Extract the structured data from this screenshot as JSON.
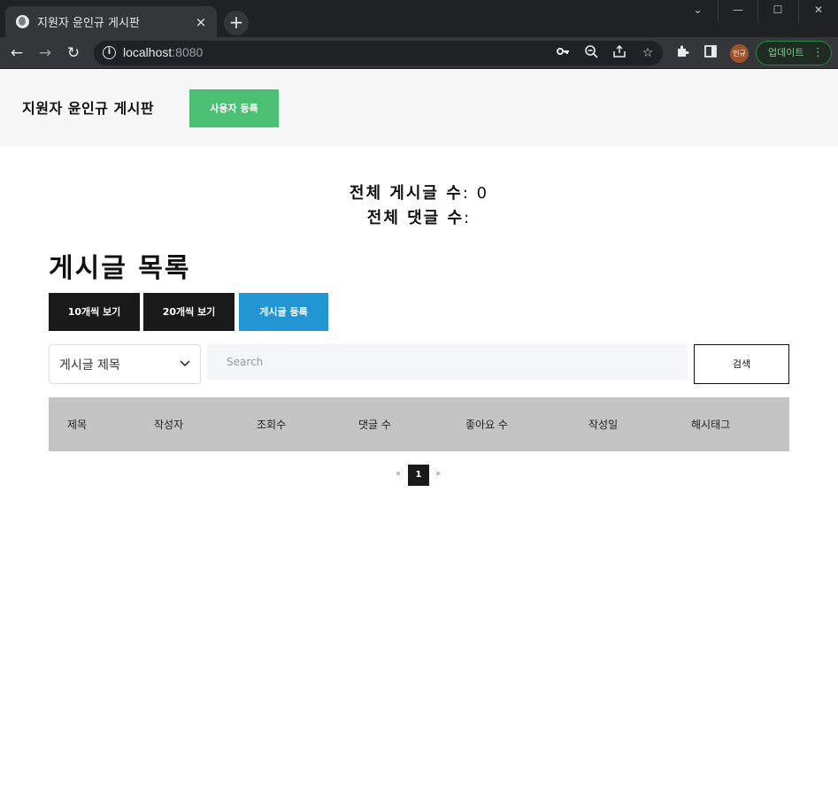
{
  "browser": {
    "tab_title": "지원자 윤인규 게시판",
    "tab_close": "×",
    "new_tab": "+",
    "url_host": "localhost",
    "url_port": ":8080",
    "profile_initials": "인규",
    "update_label": "업데이트",
    "window_controls": [
      "⌄",
      "—",
      "☐",
      "✕"
    ]
  },
  "header": {
    "site_title": "지원자 윤인규 게시판",
    "user_register_label": "사용자 등록"
  },
  "stats": {
    "total_posts_label": "전체 게시글 수",
    "total_posts_value": ": 0",
    "total_comments_label": "전체 댓글 수",
    "total_comments_value": ":"
  },
  "board": {
    "title": "게시글 목록",
    "view10_label": "10개씩 보기",
    "view20_label": "20개씩 보기",
    "post_register_label": "게시글 등록",
    "search_select_value": "게시글 제목",
    "search_placeholder": "Search",
    "search_button_label": "검색",
    "columns": [
      "제목",
      "작성자",
      "조회수",
      "댓글 수",
      "좋아요 수",
      "작성일",
      "해시태그"
    ],
    "rows": []
  },
  "pagination": {
    "prev": "«",
    "current": "1",
    "next": "»"
  },
  "colors": {
    "accent_green": "#4bbf73",
    "accent_blue": "#2196d3",
    "dark_button": "#1a1a1a",
    "table_header": "#c4c4c4"
  },
  "icons": [
    "globe-icon",
    "back-icon",
    "forward-icon",
    "reload-icon",
    "info-icon",
    "key-icon",
    "zoom-out-icon",
    "share-icon",
    "star-icon",
    "puzzle-icon",
    "sidepanel-icon",
    "more-icon",
    "chevron-down-icon"
  ]
}
